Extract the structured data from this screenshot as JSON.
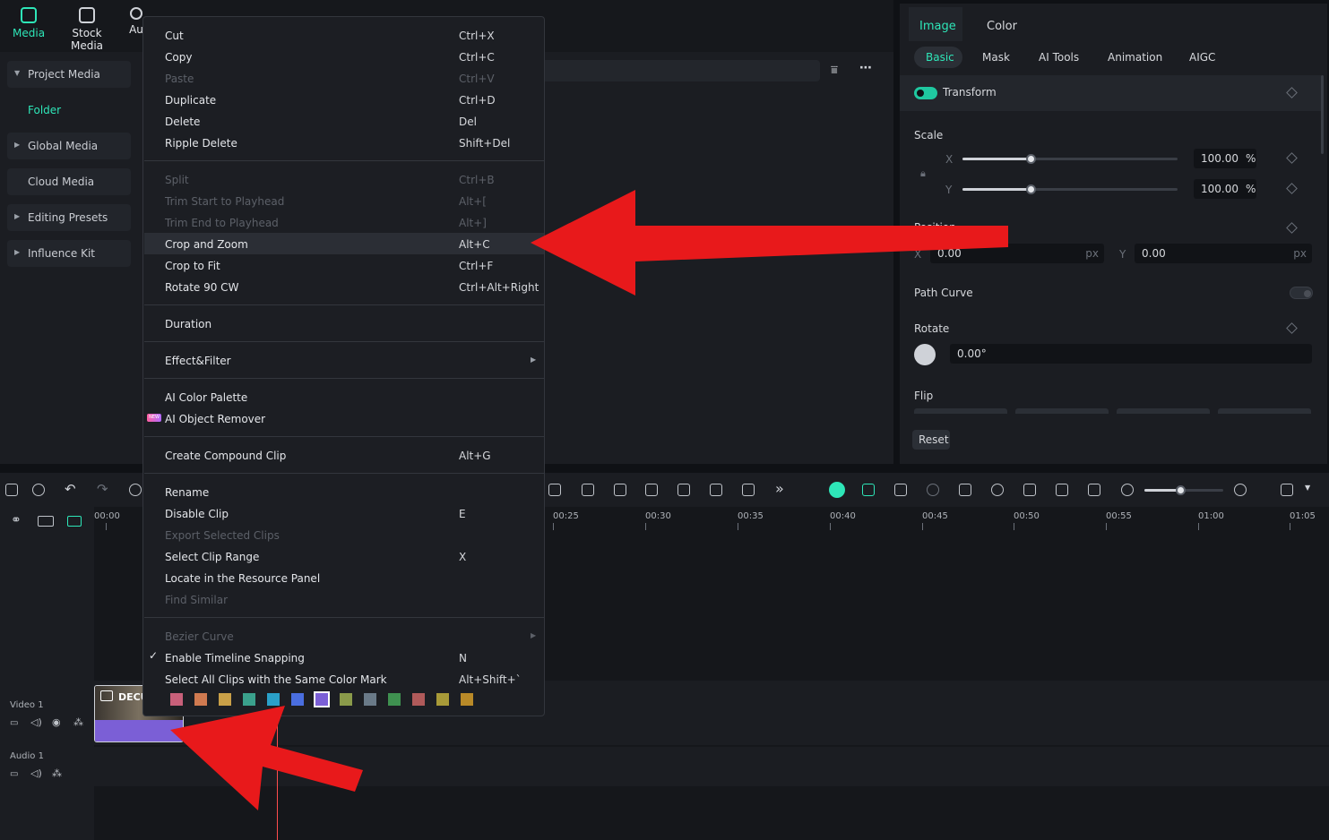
{
  "top_tabs": [
    "Media",
    "Stock Media",
    "Au"
  ],
  "side_nav": {
    "project_media": "Project Media",
    "folder": "Folder",
    "global_media": "Global Media",
    "cloud_media": "Cloud Media",
    "editing_presets": "Editing Presets",
    "influence_kit": "Influence Kit"
  },
  "props": {
    "tabs": [
      "Image",
      "Color"
    ],
    "subtabs": [
      "Basic",
      "Mask",
      "AI Tools",
      "Animation",
      "AIGC"
    ],
    "transform": "Transform",
    "scale": "Scale",
    "x": "X",
    "y": "Y",
    "scale_x": "100.00",
    "scale_y": "100.00",
    "percent": "%",
    "scale_level": 0.32,
    "position": "Position",
    "pos_x": "0.00",
    "pos_y": "0.00",
    "px": "px",
    "path_curve": "Path Curve",
    "rotate": "Rotate",
    "rotate_val": "0.00°",
    "flip": "Flip",
    "reset": "Reset"
  },
  "menu": {
    "items": [
      {
        "label": "Cut",
        "shortcut": "Ctrl+X",
        "disabled": false
      },
      {
        "label": "Copy",
        "shortcut": "Ctrl+C",
        "disabled": false
      },
      {
        "label": "Paste",
        "shortcut": "Ctrl+V",
        "disabled": true
      },
      {
        "label": "Duplicate",
        "shortcut": "Ctrl+D",
        "disabled": false
      },
      {
        "label": "Delete",
        "shortcut": "Del",
        "disabled": false
      },
      {
        "label": "Ripple Delete",
        "shortcut": "Shift+Del",
        "disabled": false
      },
      {
        "label": "Split",
        "shortcut": "Ctrl+B",
        "disabled": true
      },
      {
        "label": "Trim Start to Playhead",
        "shortcut": "Alt+[",
        "disabled": true
      },
      {
        "label": "Trim End to Playhead",
        "shortcut": "Alt+]",
        "disabled": true
      },
      {
        "label": "Crop and Zoom",
        "shortcut": "Alt+C",
        "disabled": false,
        "highlighted": true
      },
      {
        "label": "Crop to Fit",
        "shortcut": "Ctrl+F",
        "disabled": false
      },
      {
        "label": "Rotate 90 CW",
        "shortcut": "Ctrl+Alt+Right",
        "disabled": false
      },
      {
        "label": "Duration",
        "shortcut": "",
        "disabled": false
      },
      {
        "label": "Effect&Filter",
        "shortcut": "",
        "disabled": false
      },
      {
        "label": "AI Color Palette",
        "shortcut": "",
        "disabled": false
      },
      {
        "label": "AI Object Remover",
        "shortcut": "",
        "disabled": false
      },
      {
        "label": "Create Compound Clip",
        "shortcut": "Alt+G",
        "disabled": false
      },
      {
        "label": "Rename",
        "shortcut": "",
        "disabled": false
      },
      {
        "label": "Disable Clip",
        "shortcut": "E",
        "disabled": false
      },
      {
        "label": "Export Selected Clips",
        "shortcut": "",
        "disabled": true
      },
      {
        "label": "Select Clip Range",
        "shortcut": "X",
        "disabled": false
      },
      {
        "label": "Locate in the Resource Panel",
        "shortcut": "",
        "disabled": false
      },
      {
        "label": "Find Similar",
        "shortcut": "",
        "disabled": true
      },
      {
        "label": "Bezier Curve",
        "shortcut": "",
        "disabled": true
      },
      {
        "label": "Enable Timeline Snapping",
        "shortcut": "N",
        "disabled": false
      },
      {
        "label": "Select All Clips with the Same Color Mark",
        "shortcut": "Alt+Shift+`",
        "disabled": false
      }
    ],
    "new_badge": "NEW",
    "check": "✓",
    "color_marks": [
      "#c8607a",
      "#d07a50",
      "#c9a048",
      "#3aa18c",
      "#2aa0c8",
      "#4a6ee0",
      "#7b5fd6",
      "#8a9a4a",
      "#6a7a88",
      "#3f9150",
      "#b05a5a",
      "#a89a38",
      "#b98a28"
    ]
  },
  "timeline": {
    "ticks": [
      "00:00",
      "00:25",
      "00:30",
      "00:35",
      "00:40",
      "00:45",
      "00:50",
      "00:55",
      "01:00",
      "01:05"
    ],
    "video_track": "Video 1",
    "audio_track": "Audio 1",
    "clip_name": "DECU"
  }
}
